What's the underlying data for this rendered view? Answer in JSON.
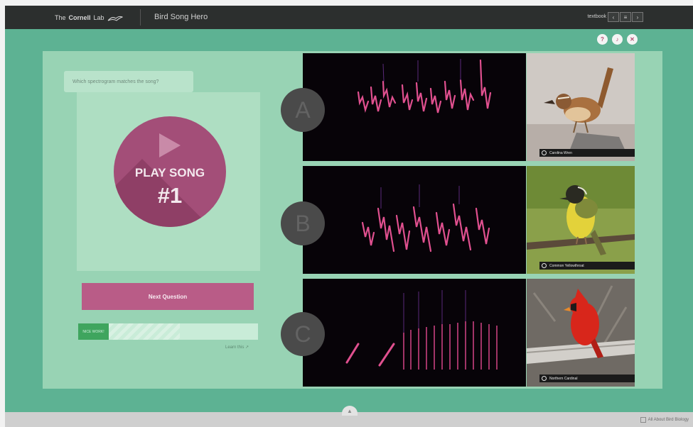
{
  "header": {
    "logo_the": "The",
    "logo_cornell": "Cornell",
    "logo_lab": "Lab",
    "app_title": "Bird Song Hero",
    "right_label": "textbook",
    "nav_buttons": [
      "‹",
      "≡",
      "›"
    ]
  },
  "toolbar_circles": [
    "?",
    "♪",
    "✕"
  ],
  "quiz": {
    "question": "Which spectrogram matches the song?",
    "play_label": "PLAY SONG",
    "play_number": "#1",
    "next_label": "Next Question",
    "progress_label": "NICE WORK!",
    "progress_fraction": 0.17,
    "learn_link": "Learn this ↗"
  },
  "answers": [
    {
      "letter": "A",
      "bird_name": "Carolina Wren"
    },
    {
      "letter": "B",
      "bird_name": "Common Yellowthroat"
    },
    {
      "letter": "C",
      "bird_name": "Northern Cardinal"
    }
  ],
  "footer": {
    "tab_icon": "chevron-up-icon",
    "link": "All About Bird Biology"
  },
  "colors": {
    "teal": "#5db293",
    "panel": "#98d3b4",
    "accent": "#b95c87",
    "play_circle": "#a34e78",
    "spectrogram_bg": "#070308",
    "spectrogram_trace": "#e0508f"
  }
}
